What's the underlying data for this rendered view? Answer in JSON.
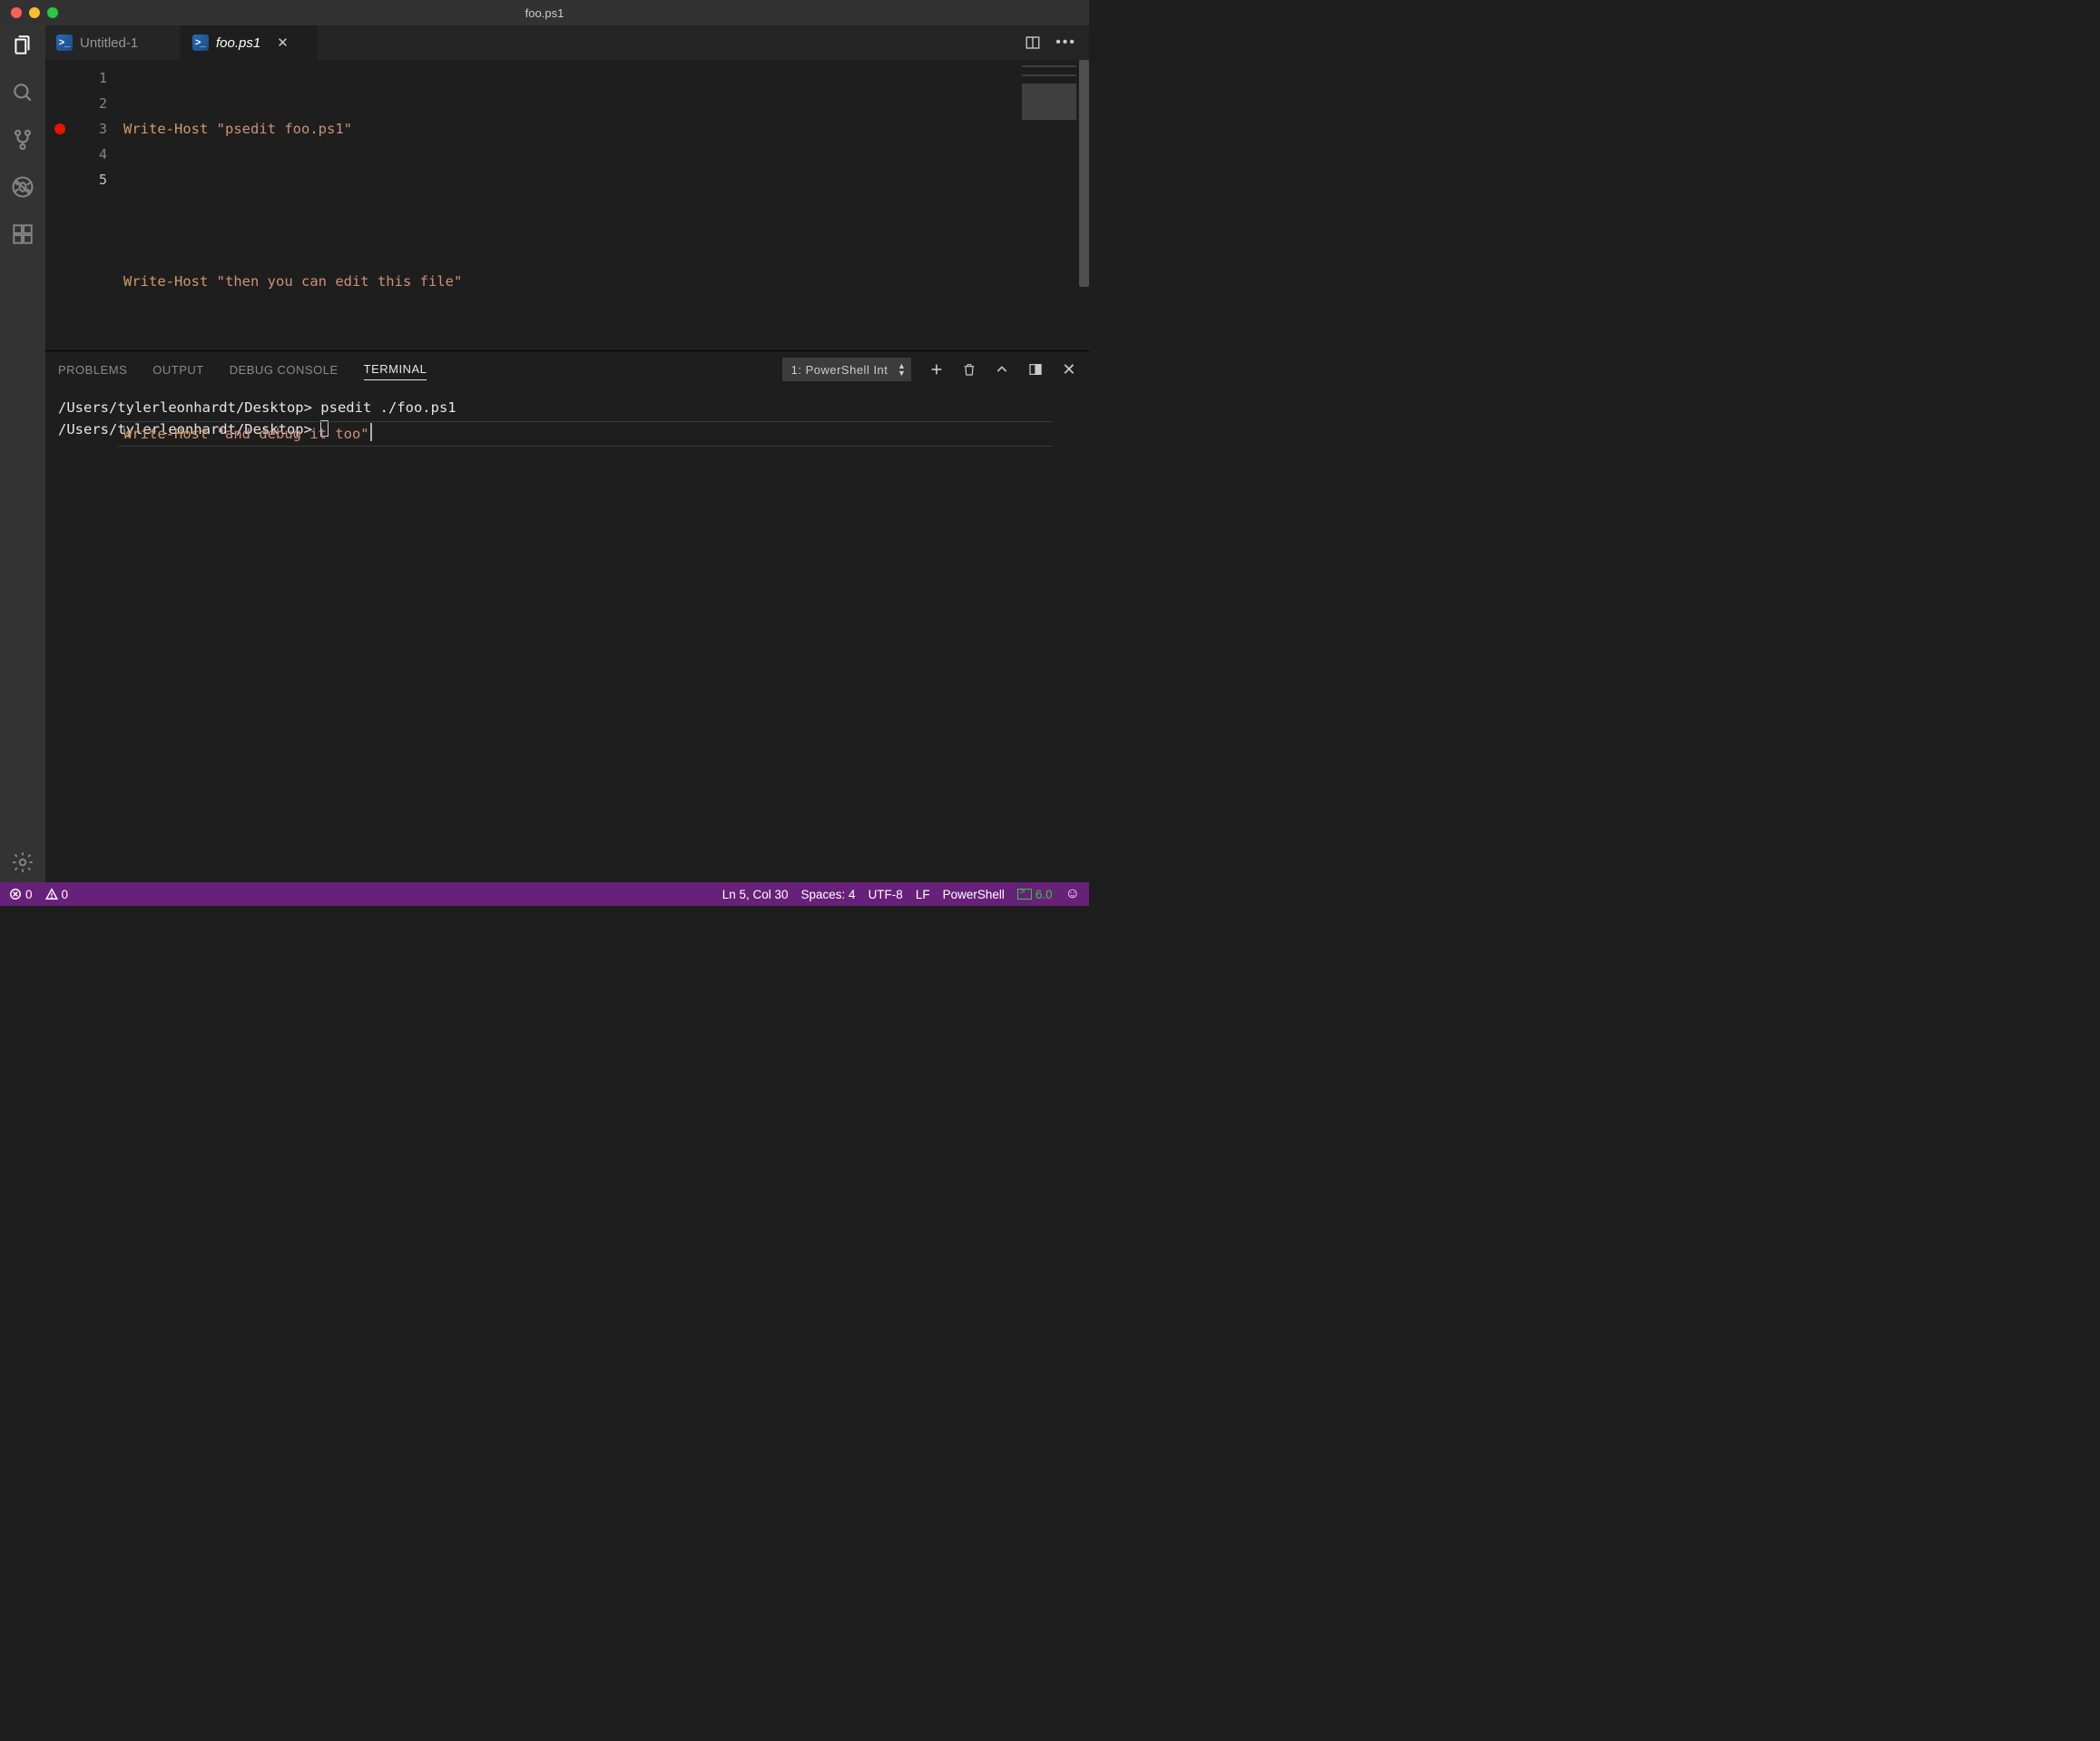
{
  "window": {
    "title": "foo.ps1"
  },
  "tabs": [
    {
      "label": "Untitled-1",
      "active": false
    },
    {
      "label": "foo.ps1",
      "active": true
    }
  ],
  "editor": {
    "breakpoints": [
      3
    ],
    "current_line_index": 4,
    "lines": [
      {
        "num": "1",
        "fn": "Write-Host",
        "str": "\"psedit foo.ps1\""
      },
      {
        "num": "2",
        "fn": "",
        "str": ""
      },
      {
        "num": "3",
        "fn": "Write-Host",
        "str": "\"then you can edit this file\""
      },
      {
        "num": "4",
        "fn": "",
        "str": ""
      },
      {
        "num": "5",
        "fn": "Write-Host",
        "str": "\"and debug it too\""
      }
    ]
  },
  "panel": {
    "tabs": {
      "problems": "PROBLEMS",
      "output": "OUTPUT",
      "debug_console": "DEBUG CONSOLE",
      "terminal": "TERMINAL"
    },
    "terminal_selector": "1: PowerShell Int",
    "terminal_lines": [
      {
        "prompt": "/Users/tylerleonhardt/Desktop>",
        "cmd": " psedit ./foo.ps1"
      },
      {
        "prompt": "/Users/tylerleonhardt/Desktop>",
        "cmd": " "
      }
    ]
  },
  "status": {
    "errors": "0",
    "warnings": "0",
    "cursor": "Ln 5, Col 30",
    "indent": "Spaces: 4",
    "encoding": "UTF-8",
    "eol": "LF",
    "language": "PowerShell",
    "ps_version": "6.0"
  }
}
